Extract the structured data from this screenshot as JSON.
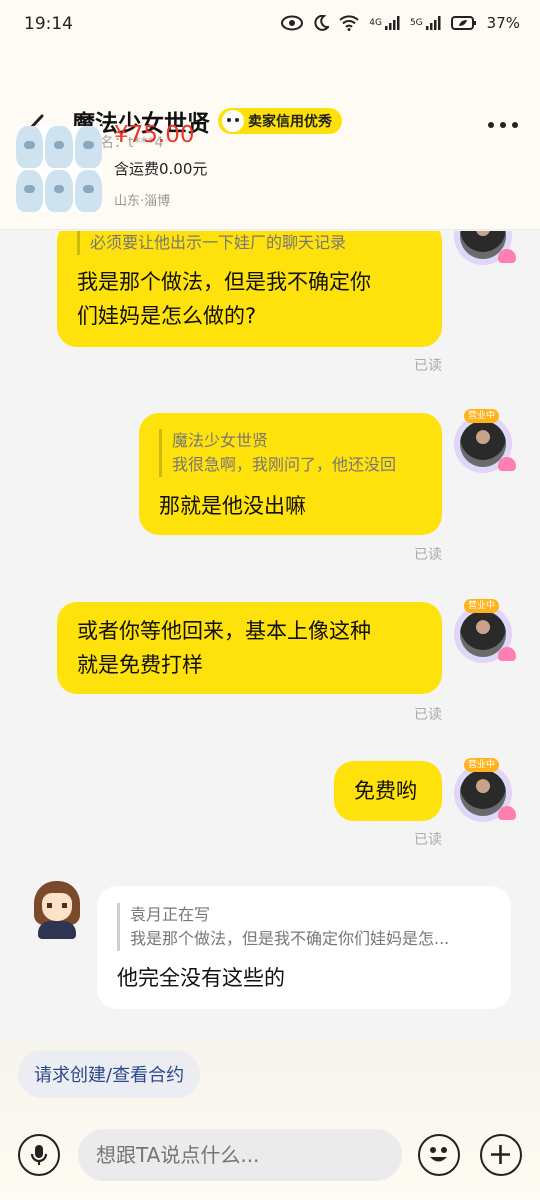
{
  "status": {
    "time": "19:14",
    "net1": "4G",
    "net2": "5G",
    "battery": "37%"
  },
  "header": {
    "title": "魔法少女世贤",
    "credit_badge": "卖家信用优秀",
    "member": "会员名：t***4",
    "more_icon": "more-dots-icon",
    "back_icon": "chevron-left-icon"
  },
  "product": {
    "price": "¥75.00",
    "shipping": "含运费0.00元",
    "location": "山东·淄博"
  },
  "seller_avatar_tag": "营业中",
  "messages": [
    {
      "quote_line": "必须要让他出示一下娃厂的聊天记录",
      "lines": [
        "我是那个做法，但是我不确定你",
        "们娃妈是怎么做的?"
      ],
      "status": "已读"
    },
    {
      "quote_name": "魔法少女世贤",
      "quote_line": "我很急啊，我刚问了，他还没回",
      "lines": [
        "那就是他没出嘛"
      ],
      "status": "已读"
    },
    {
      "lines": [
        "或者你等他回来，基本上像这种",
        "就是免费打样"
      ],
      "status": "已读"
    },
    {
      "lines": [
        "免费哟"
      ],
      "status": "已读"
    },
    {
      "quote_name": "袁月正在写",
      "quote_line": "我是那个做法，但是我不确定你们娃妈是怎...",
      "lines": [
        "他完全没有这些的"
      ]
    }
  ],
  "bottom": {
    "contract": "请求创建/查看合约",
    "placeholder": "想跟TA说点什么..."
  },
  "colors": {
    "my_bubble": "#ffe20b",
    "price": "#e8362f",
    "badge": "#ffe10a"
  }
}
